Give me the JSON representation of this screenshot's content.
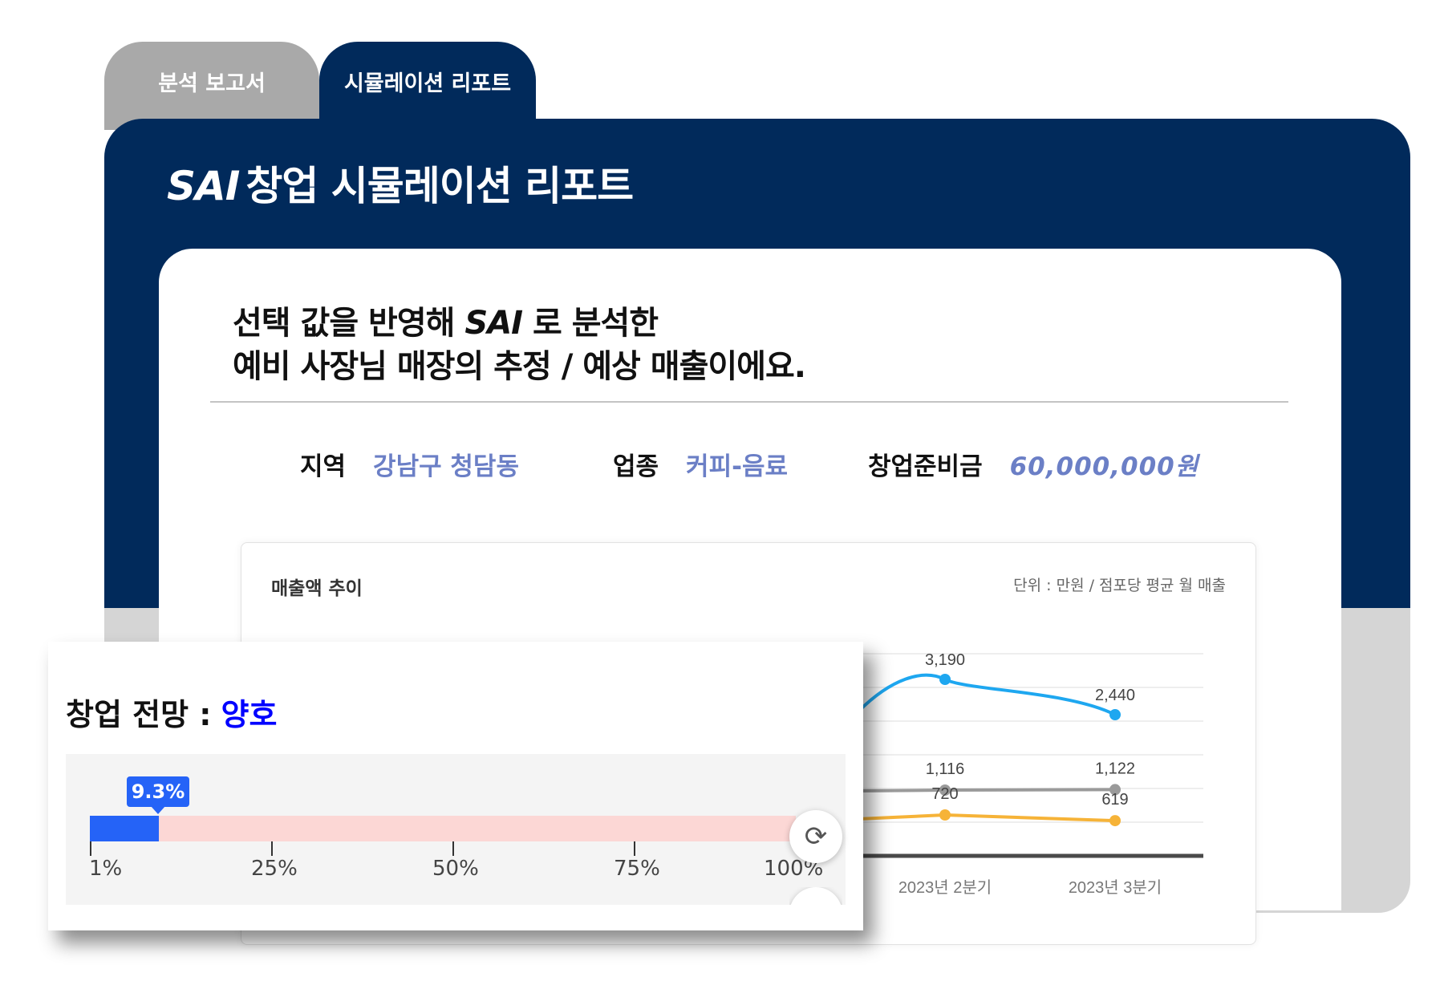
{
  "tabs": [
    {
      "label": "분석 보고서",
      "active": false
    },
    {
      "label": "시뮬레이션 리포트",
      "active": true
    }
  ],
  "report": {
    "brand": "SAI",
    "title": "창업 시뮬레이션 리포트"
  },
  "headline": {
    "line1_pre": "선택 값을 반영해",
    "line1_brand": "SAI",
    "line1_post": "로 분석한",
    "line2": "예비 사장님 매장의 추정 / 예상 매출이에요."
  },
  "selection": {
    "region_label": "지역",
    "region_value": "강남구 청담동",
    "industry_label": "업종",
    "industry_value": "커피-음료",
    "budget_label": "창업준비금",
    "budget_value": "60,000,000원"
  },
  "sales_chart": {
    "title": "매출액 추이",
    "unit": "단위 : 만원 / 점포당 평균 월 매출"
  },
  "chart_data": {
    "type": "line",
    "categories": [
      "2023년 2분기",
      "2023년 3분기"
    ],
    "series": [
      {
        "values": [
          3190,
          2440
        ],
        "color": "#1ea7f0"
      },
      {
        "values": [
          1116,
          1122
        ],
        "color": "#9a9a9a"
      },
      {
        "values": [
          720,
          619
        ],
        "color": "#f6b338"
      }
    ],
    "data_labels": [
      "3,190",
      "2,440",
      "1,116",
      "1,122",
      "720",
      "619"
    ],
    "title": "",
    "xlabel": "",
    "ylabel": ""
  },
  "outlook": {
    "label": "창업 전망 :",
    "value": "양호",
    "value_color": "#0000ff",
    "percent_label": "9.3%",
    "percent": 9.3,
    "ticks": [
      "1%",
      "25%",
      "50%",
      "75%",
      "100%"
    ],
    "fill_color": "#2563f7",
    "track_color": "#fcd7d5"
  },
  "colors": {
    "navy": "#012a5b",
    "accent_value": "#6b7fc6"
  },
  "icons": {
    "refresh": "refresh-icon"
  }
}
